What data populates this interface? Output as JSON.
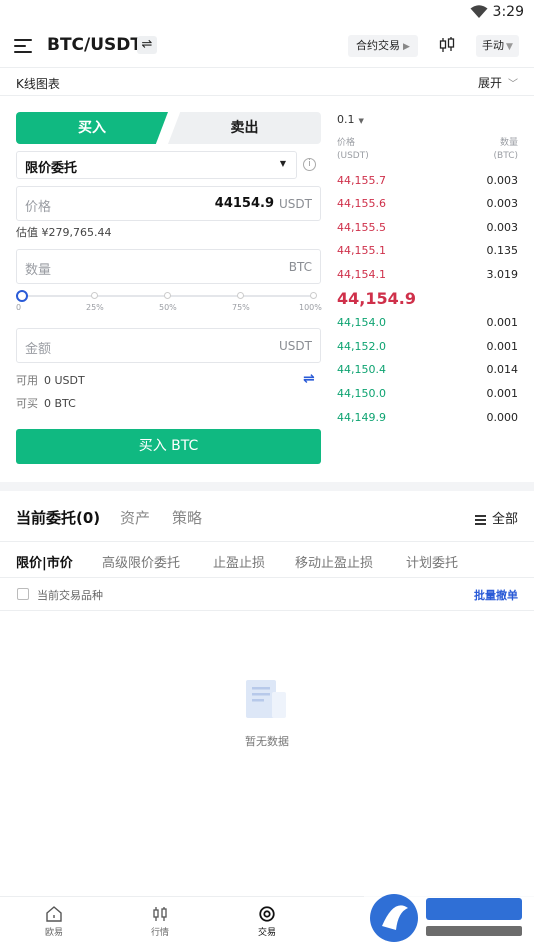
{
  "status_bar": {
    "time": "3:29"
  },
  "header": {
    "pair": "BTC/USDT",
    "swap_glyph": "⇌",
    "futures_label": "合约交易",
    "manual_label": "手动"
  },
  "kline": {
    "label": "K线图表",
    "expand_label": "展开"
  },
  "trade": {
    "buy_tab": "买入",
    "sell_tab": "卖出",
    "order_type": "限价委托",
    "price_placeholder": "价格",
    "price_value": "44154.9",
    "price_unit": "USDT",
    "estimate": "估值 ¥279,765.44",
    "quantity_placeholder": "数量",
    "quantity_unit": "BTC",
    "slider": {
      "value_percent": 0,
      "marks": [
        "0",
        "25%",
        "50%",
        "75%",
        "100%"
      ]
    },
    "amount_placeholder": "金额",
    "amount_unit": "USDT",
    "available_key": "可用",
    "available_value": "0 USDT",
    "buyable_key": "可买",
    "buyable_value": "0 BTC",
    "buy_button": "买入 BTC"
  },
  "orderbook": {
    "depth": "0.1",
    "price_header": "价格",
    "price_header_unit": "(USDT)",
    "qty_header": "数量",
    "qty_header_unit": "(BTC)",
    "asks": [
      {
        "price": "44,155.7",
        "qty": "0.003"
      },
      {
        "price": "44,155.6",
        "qty": "0.003"
      },
      {
        "price": "44,155.5",
        "qty": "0.003"
      },
      {
        "price": "44,155.1",
        "qty": "0.135"
      },
      {
        "price": "44,154.1",
        "qty": "3.019"
      }
    ],
    "last_price": "44,154.9",
    "bids": [
      {
        "price": "44,154.0",
        "qty": "0.001"
      },
      {
        "price": "44,152.0",
        "qty": "0.001"
      },
      {
        "price": "44,150.4",
        "qty": "0.014"
      },
      {
        "price": "44,150.0",
        "qty": "0.001"
      },
      {
        "price": "44,149.9",
        "qty": "0.000"
      }
    ]
  },
  "orders": {
    "tabs": [
      "当前委托(0)",
      "资产",
      "策略"
    ],
    "all_label": "全部",
    "sub_tabs": [
      "限价|市价",
      "高级限价委托",
      "止盈止损",
      "移动止盈止损",
      "计划委托"
    ],
    "filter_label": "当前交易品种",
    "batch_cancel": "批量撤单",
    "empty_text": "暂无数据"
  },
  "bottom_nav": [
    {
      "label": "欧易",
      "icon": "home-icon"
    },
    {
      "label": "行情",
      "icon": "market-icon"
    },
    {
      "label": "交易",
      "icon": "trade-icon"
    }
  ],
  "colors": {
    "buy_green": "#10b981",
    "ask_red": "#cf304a",
    "bid_green": "#0ea371",
    "link_blue": "#2a5bd7"
  }
}
